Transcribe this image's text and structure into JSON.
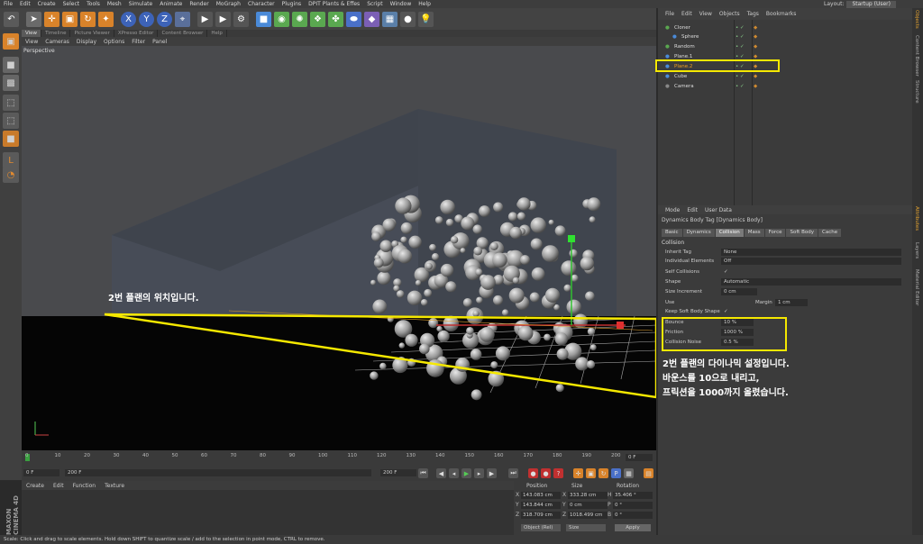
{
  "menubar": {
    "items": [
      "File",
      "Edit",
      "Create",
      "Select",
      "Tools",
      "Mesh",
      "Simulate",
      "Animate",
      "Render",
      "MoGraph",
      "Character",
      "Plugins",
      "DPIT Plants & Effes",
      "Script",
      "Window",
      "Help"
    ],
    "layout_label": "Layout:",
    "layout_value": "Startup (User)"
  },
  "viewport_tabs": [
    "View",
    "Timeline",
    "Picture Viewer",
    "XPresso Editor",
    "Content Browser",
    "Help"
  ],
  "viewport_menu": [
    "View",
    "Cameras",
    "Display",
    "Options",
    "Filter",
    "Panel"
  ],
  "viewport_label": "Perspective",
  "object_manager": {
    "menu": [
      "File",
      "Edit",
      "View",
      "Objects",
      "Tags",
      "Bookmarks"
    ],
    "objects": [
      "Cloner",
      "Sphere",
      "Random",
      "Plane.1",
      "Plane.2",
      "Cube",
      "Camera"
    ]
  },
  "attributes": {
    "menu": [
      "Mode",
      "Edit",
      "User Data"
    ],
    "title": "Dynamics Body Tag [Dynamics Body]",
    "tabs": [
      "Basic",
      "Dynamics",
      "Collision",
      "Mass",
      "Force",
      "Soft Body",
      "Cache"
    ],
    "active_tab": "Collision",
    "section": "Collision",
    "rows": [
      {
        "label": "Inherit Tag",
        "value": "None"
      },
      {
        "label": "Individual Elements",
        "value": "Off"
      },
      {
        "label": "Self Collisions",
        "value": "✓"
      },
      {
        "label": "Shape",
        "value": "Automatic"
      },
      {
        "label": "Size Increment",
        "value": "0 cm"
      },
      {
        "label": "Use",
        "value": ""
      },
      {
        "label": "Keep Soft Body Shape",
        "value": "✓"
      },
      {
        "label": "Bounce",
        "value": "10 %"
      },
      {
        "label": "Friction",
        "value": "1000 %"
      },
      {
        "label": "Collision Noise",
        "value": "0.5 %"
      }
    ],
    "margin_label": "Margin",
    "margin_value": "1 cm"
  },
  "timeline": {
    "ticks": [
      "0",
      "10",
      "20",
      "30",
      "40",
      "50",
      "60",
      "70",
      "80",
      "90",
      "100",
      "110",
      "120",
      "130",
      "140",
      "150",
      "160",
      "170",
      "180",
      "190",
      "200"
    ],
    "current_frame": "0 F",
    "start_field": "0 F",
    "end_field": "200 F",
    "scale_field": "200 F",
    "end_field2": "200 F"
  },
  "material_menu": [
    "Create",
    "Edit",
    "Function",
    "Texture"
  ],
  "coords": {
    "headers": [
      "Position",
      "Size",
      "Rotation"
    ],
    "rows": [
      {
        "axis": "X",
        "pos": "143.083 cm",
        "size_axis": "X",
        "size": "333.28 cm",
        "rot_axis": "H",
        "rot": "35.406 °"
      },
      {
        "axis": "Y",
        "pos": "143.844 cm",
        "size_axis": "Y",
        "size": "0 cm",
        "rot_axis": "P",
        "rot": "0 °"
      },
      {
        "axis": "Z",
        "pos": "318.709 cm",
        "size_axis": "Z",
        "size": "1018.499 cm",
        "rot_axis": "B",
        "rot": "0 °"
      }
    ],
    "mode1": "Object (Rel)",
    "mode2": "Size",
    "apply": "Apply"
  },
  "status_text": "Scale: Click and drag to scale elements. Hold down SHIFT to quantize scale / add to the selection in point mode, CTRL to remove.",
  "logo_text": "MAXON CINEMA 4D",
  "side_tabs": [
    "Objects",
    "Content Browser",
    "Structure",
    "Attributes",
    "Layers",
    "Material Editor"
  ],
  "annotations": {
    "plane_note": "2번 플랜의 위치입니다.",
    "dyn_line1": "2번 플랜의 다이나믹 설정입니다.",
    "dyn_line2": "바운스를 10으로 내리고,",
    "dyn_line3": "프릭션을 1000까지 올렸습니다."
  },
  "colors": {
    "highlight": "#f5e800",
    "accent": "#f0a020"
  }
}
